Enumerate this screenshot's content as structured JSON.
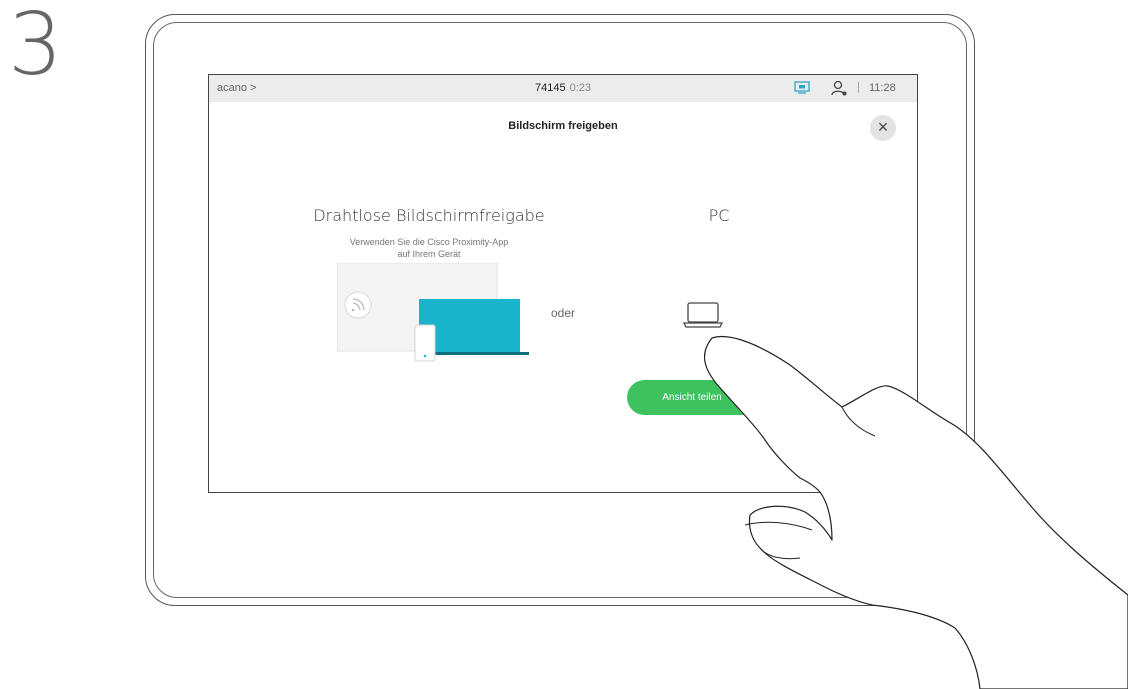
{
  "step": {
    "number": "3"
  },
  "topbar": {
    "breadcrumb": "acano >",
    "call_number": "74145",
    "call_duration": "0:23",
    "separator": "|",
    "time": "11:28",
    "share_indicator_icon": "screen-share-icon",
    "person_icon": "person-icon"
  },
  "dialog": {
    "title": "Bildschirm freigeben",
    "close_label": "×",
    "wireless": {
      "title": "Drahtlose Bildschirmfreigabe",
      "desc_line1": "Verwenden Sie die Cisco Proximity-App",
      "desc_line2": "auf Ihrem Gerät"
    },
    "or_label": "oder",
    "pc": {
      "title": "PC",
      "share_button": "Ansicht teilen"
    }
  },
  "colors": {
    "accent_green": "#3ec15f",
    "laptop_teal": "#19b4cc",
    "indicator_blue": "#2fa4c9"
  }
}
